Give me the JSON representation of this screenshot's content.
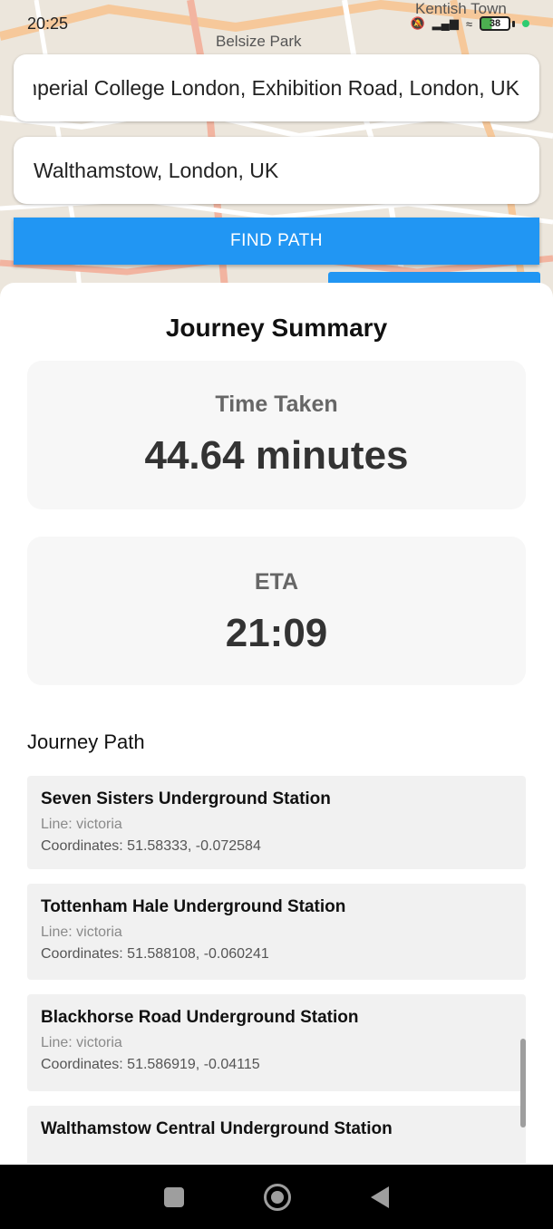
{
  "status_bar": {
    "time": "20:25",
    "battery": "38"
  },
  "map": {
    "labels": [
      "Belsize Park",
      "Kentish Town"
    ]
  },
  "search": {
    "origin_value": "Imperial College London, Exhibition Road, London, UK",
    "destination_value": "Walthamstow, London, UK",
    "find_button_label": "FIND PATH"
  },
  "summary": {
    "title": "Journey Summary",
    "time_label": "Time Taken",
    "time_value": "44.64 minutes",
    "eta_label": "ETA",
    "eta_value": "21:09"
  },
  "journey_path": {
    "title": "Journey Path",
    "stops": [
      {
        "name": "Seven Sisters Underground Station",
        "line": "Line: victoria",
        "coords": "Coordinates: 51.58333, -0.072584"
      },
      {
        "name": "Tottenham Hale Underground Station",
        "line": "Line: victoria",
        "coords": "Coordinates: 51.588108, -0.060241"
      },
      {
        "name": "Blackhorse Road Underground Station",
        "line": "Line: victoria",
        "coords": "Coordinates: 51.586919, -0.04115"
      },
      {
        "name": "Walthamstow Central Underground Station",
        "line": "",
        "coords": ""
      }
    ]
  },
  "colors": {
    "accent": "#2196f3",
    "card_bg": "#f7f7f7",
    "stop_bg": "#f1f1f1"
  },
  "icons": {
    "nav": [
      "recents-icon",
      "home-icon",
      "back-icon"
    ]
  }
}
